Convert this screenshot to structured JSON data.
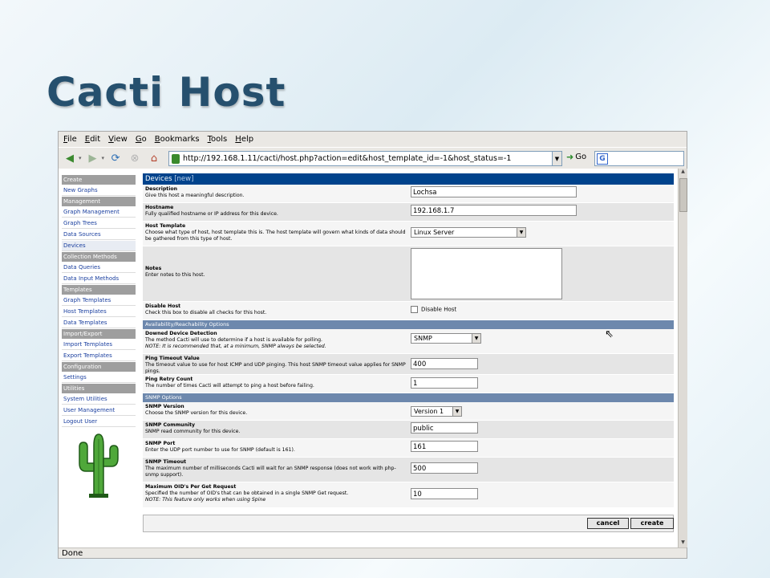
{
  "slide": {
    "title": "Cacti Host"
  },
  "browser": {
    "menu": [
      "File",
      "Edit",
      "View",
      "Go",
      "Bookmarks",
      "Tools",
      "Help"
    ],
    "url": "http://192.168.1.11/cacti/host.php?action=edit&host_template_id=-1&host_status=-1",
    "go_label": "Go",
    "status": "Done"
  },
  "sidebar": [
    {
      "type": "header",
      "label": "Create"
    },
    {
      "type": "link",
      "label": "New Graphs"
    },
    {
      "type": "header",
      "label": "Management"
    },
    {
      "type": "link",
      "label": "Graph Management"
    },
    {
      "type": "link",
      "label": "Graph Trees"
    },
    {
      "type": "link",
      "label": "Data Sources"
    },
    {
      "type": "link",
      "label": "Devices",
      "active": true
    },
    {
      "type": "header",
      "label": "Collection Methods"
    },
    {
      "type": "link",
      "label": "Data Queries"
    },
    {
      "type": "link",
      "label": "Data Input Methods"
    },
    {
      "type": "header",
      "label": "Templates"
    },
    {
      "type": "link",
      "label": "Graph Templates"
    },
    {
      "type": "link",
      "label": "Host Templates"
    },
    {
      "type": "link",
      "label": "Data Templates"
    },
    {
      "type": "header",
      "label": "Import/Export"
    },
    {
      "type": "link",
      "label": "Import Templates"
    },
    {
      "type": "link",
      "label": "Export Templates"
    },
    {
      "type": "header",
      "label": "Configuration"
    },
    {
      "type": "link",
      "label": "Settings"
    },
    {
      "type": "header",
      "label": "Utilities"
    },
    {
      "type": "link",
      "label": "System Utilities"
    },
    {
      "type": "link",
      "label": "User Management"
    },
    {
      "type": "link",
      "label": "Logout User"
    }
  ],
  "form": {
    "title": "Devices",
    "title_tag": "[new]",
    "description": {
      "label": "Description",
      "help": "Give this host a meaningful description.",
      "value": "Lochsa"
    },
    "hostname": {
      "label": "Hostname",
      "help": "Fully qualified hostname or IP address for this device.",
      "value": "192.168.1.7"
    },
    "host_template": {
      "label": "Host Template",
      "help": "Choose what type of host, host template this is. The host template will govern what kinds of data should be gathered from this type of host.",
      "value": "Linux Server"
    },
    "notes": {
      "label": "Notes",
      "help": "Enter notes to this host."
    },
    "disable_host": {
      "label": "Disable Host",
      "help": "Check this box to disable all checks for this host.",
      "checkbox_label": "Disable Host"
    },
    "section_availability": "Availability/Reachability Options",
    "downed_detection": {
      "label": "Downed Device Detection",
      "help": "The method Cacti will use to determine if a host is available for polling.",
      "note": "NOTE: It is recommended that, at a minimum, SNMP always be selected.",
      "value": "SNMP"
    },
    "ping_timeout": {
      "label": "Ping Timeout Value",
      "help": "The timeout value to use for host ICMP and UDP pinging. This host SNMP timeout value applies for SNMP pings.",
      "value": "400"
    },
    "ping_retry": {
      "label": "Ping Retry Count",
      "help": "The number of times Cacti will attempt to ping a host before failing.",
      "value": "1"
    },
    "section_snmp": "SNMP Options",
    "snmp_version": {
      "label": "SNMP Version",
      "help": "Choose the SNMP version for this device.",
      "value": "Version 1"
    },
    "snmp_community": {
      "label": "SNMP Community",
      "help": "SNMP read community for this device.",
      "value": "public"
    },
    "snmp_port": {
      "label": "SNMP Port",
      "help": "Enter the UDP port number to use for SNMP (default is 161).",
      "value": "161"
    },
    "snmp_timeout": {
      "label": "SNMP Timeout",
      "help": "The maximum number of milliseconds Cacti will wait for an SNMP response (does not work with php-snmp support).",
      "value": "500"
    },
    "max_oids": {
      "label": "Maximum OID's Per Get Request",
      "help": "Specified the number of OID's that can be obtained in a single SNMP Get request.",
      "note": "NOTE: This feature only works when using Spine",
      "value": "10"
    },
    "cancel_label": "cancel",
    "create_label": "create"
  }
}
